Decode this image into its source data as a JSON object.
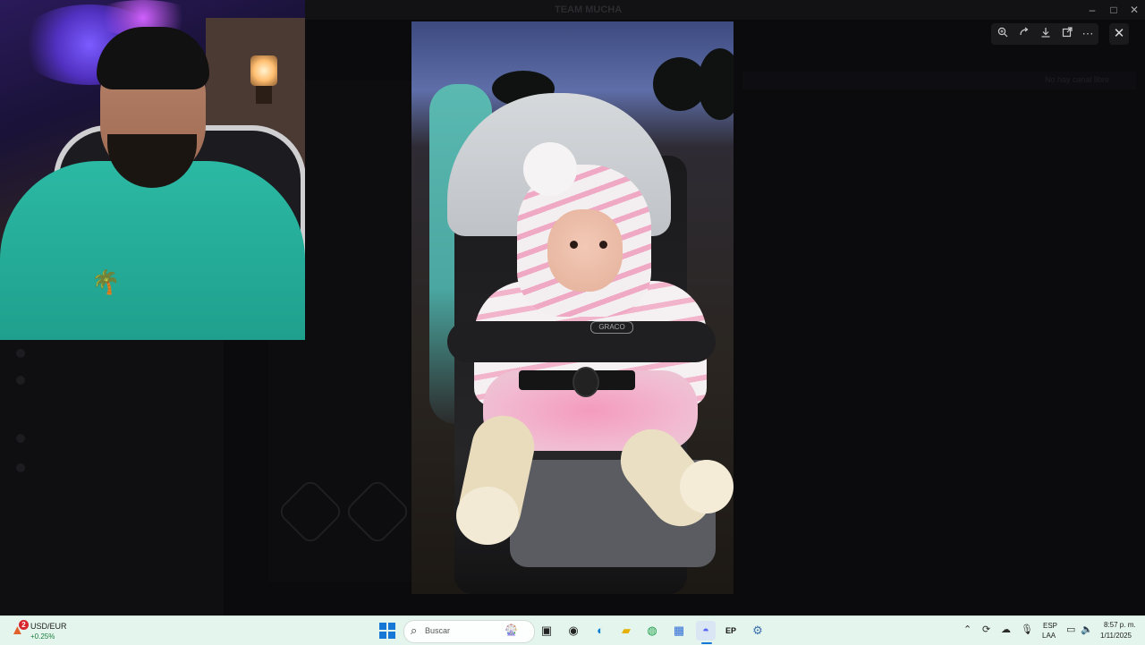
{
  "background_app": {
    "title": "TEAM MUCHA",
    "right_bar_text": "No hay canal libre"
  },
  "viewer": {
    "toolbar": {
      "zoom": "zoom-in-icon",
      "rotate": "rotate-icon",
      "download": "download-icon",
      "open_external": "open-external-icon",
      "more": "more-icon",
      "close": "✕"
    },
    "photo_brand": "GRACO"
  },
  "window_controls": {
    "minimize": "–",
    "maximize": "□",
    "close": "✕"
  },
  "taskbar": {
    "widget": {
      "badge": "2",
      "title": "USD/EUR",
      "change": "+0.25%"
    },
    "search": {
      "placeholder": "Buscar"
    },
    "language": {
      "line1": "ESP",
      "line2": "LAA"
    },
    "clock": {
      "time": "8:57 p. m.",
      "date": "1/11/2025"
    },
    "accent": "#1677d6"
  }
}
